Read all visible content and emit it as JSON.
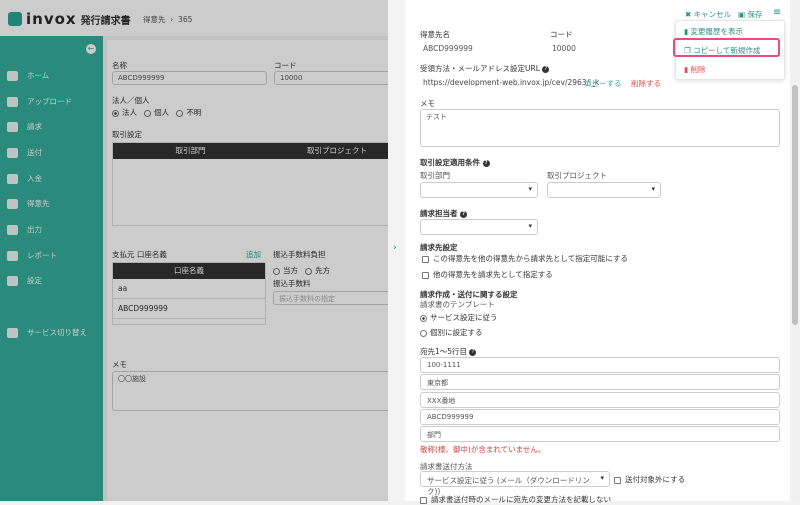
{
  "header": {
    "brand": "invox",
    "product": "発行請求書",
    "breadcrumb": [
      "得意先",
      "365"
    ]
  },
  "sidebar": {
    "items": [
      {
        "label": "ホーム",
        "icon": "home-icon"
      },
      {
        "label": "アップロード",
        "icon": "cloud-upload-icon"
      },
      {
        "label": "請求",
        "icon": "file-icon"
      },
      {
        "label": "送付",
        "icon": "send-icon"
      },
      {
        "label": "入金",
        "icon": "bank-icon"
      },
      {
        "label": "得意先",
        "icon": "building-icon"
      },
      {
        "label": "出力",
        "icon": "export-icon"
      },
      {
        "label": "レポート",
        "icon": "chart-icon"
      },
      {
        "label": "設定",
        "icon": "gear-icon"
      },
      {
        "label": "サービス切り替え",
        "icon": "switch-icon"
      }
    ]
  },
  "bg": {
    "name_label": "名称",
    "name_value": "ABCD999999",
    "code_label": "コード",
    "code_value": "10000",
    "entity_label": "法人／個人",
    "entity_options": [
      "法人",
      "個人",
      "不明"
    ],
    "trade_label": "取引設定",
    "trade_cols": [
      "取引部門",
      "取引プロジェクト"
    ],
    "payer_label": "支払元 口座名義",
    "add": "追加",
    "account_col": "口座名義",
    "accounts": [
      "aa",
      "ABCD999999"
    ],
    "fee_burden_label": "振込手数料負担",
    "fee_options": [
      "当方",
      "先方"
    ],
    "fee_label": "振込手数料",
    "fee_placeholder": "振込手数料の指定",
    "memo_label": "メモ",
    "memo_value": "〇〇施設"
  },
  "panel": {
    "toolbar": {
      "cancel": "キャンセル",
      "save": "保存"
    },
    "menu": {
      "items": [
        "変更履歴を表示",
        "コピーして新規作成",
        "削除"
      ]
    },
    "customer_label": "得意先名",
    "customer_value": "ABCD999999",
    "code_label": "コード",
    "code_value": "10000",
    "url_label": "受領方法・メールアドレス設定URL",
    "url_value": "https://development-web.invox.jp/cev/2963/i_k",
    "copy": "コピーする",
    "delete": "削除する",
    "memo_label": "メモ",
    "memo_value": "テスト",
    "cond_label": "取引設定適用条件",
    "dept_label": "取引部門",
    "project_label": "取引プロジェクト",
    "owner_label": "請求担当者",
    "billto_label": "請求先設定",
    "billto_opts": [
      "この得意先を他の得意先から請求先として指定可能にする",
      "他の得意先を請求先として指定する"
    ],
    "create_label": "請求作成・送付に関する設定",
    "template_label": "請求書のテンプレート",
    "template_opts": [
      "サービス設定に従う",
      "個別に設定する"
    ],
    "address_label": "宛先1〜5行目",
    "address": [
      "100-1111",
      "東京都",
      "XXX番地",
      "ABCD999999",
      "部門"
    ],
    "address_error": "敬称(様、御中)が含まれていません。",
    "send_label": "請求書送付方法",
    "send_value": "サービス設定に従う (メール（ダウンロードリンク))",
    "exclude": "送付対象外にする",
    "no_change_note": "請求書送付時のメールに宛先の変更方法を記載しない"
  }
}
